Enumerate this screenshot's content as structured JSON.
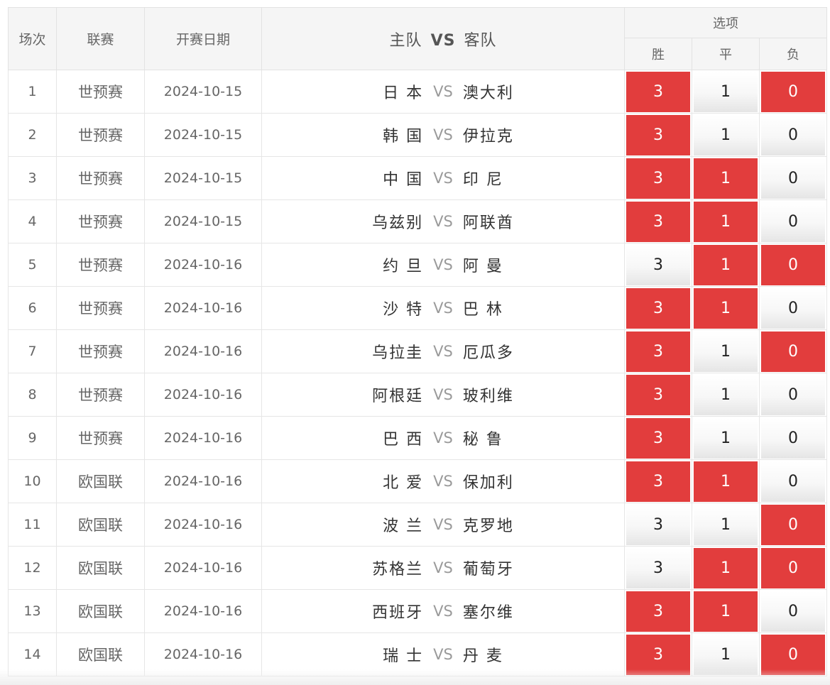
{
  "header": {
    "col_no": "场次",
    "col_league": "联赛",
    "col_date": "开赛日期",
    "col_home": "主队",
    "col_vs": "VS",
    "col_away": "客队",
    "col_options": "选项",
    "opt_win": "胜",
    "opt_draw": "平",
    "opt_lose": "负"
  },
  "colors": {
    "selected": "#e23d3d",
    "header_bg": "#f5f5f5"
  },
  "matches": [
    {
      "no": "1",
      "league": "世预赛",
      "date": "2024-10-15",
      "home": "日 本",
      "vs": "VS",
      "away": "澳大利",
      "win": "3",
      "draw": "1",
      "lose": "0",
      "sel_win": true,
      "sel_draw": false,
      "sel_lose": true
    },
    {
      "no": "2",
      "league": "世预赛",
      "date": "2024-10-15",
      "home": "韩 国",
      "vs": "VS",
      "away": "伊拉克",
      "win": "3",
      "draw": "1",
      "lose": "0",
      "sel_win": true,
      "sel_draw": false,
      "sel_lose": false
    },
    {
      "no": "3",
      "league": "世预赛",
      "date": "2024-10-15",
      "home": "中 国",
      "vs": "VS",
      "away": "印 尼",
      "win": "3",
      "draw": "1",
      "lose": "0",
      "sel_win": true,
      "sel_draw": true,
      "sel_lose": false
    },
    {
      "no": "4",
      "league": "世预赛",
      "date": "2024-10-15",
      "home": "乌兹别",
      "vs": "VS",
      "away": "阿联酋",
      "win": "3",
      "draw": "1",
      "lose": "0",
      "sel_win": true,
      "sel_draw": true,
      "sel_lose": false
    },
    {
      "no": "5",
      "league": "世预赛",
      "date": "2024-10-16",
      "home": "约 旦",
      "vs": "VS",
      "away": "阿 曼",
      "win": "3",
      "draw": "1",
      "lose": "0",
      "sel_win": false,
      "sel_draw": true,
      "sel_lose": true
    },
    {
      "no": "6",
      "league": "世预赛",
      "date": "2024-10-16",
      "home": "沙 特",
      "vs": "VS",
      "away": "巴 林",
      "win": "3",
      "draw": "1",
      "lose": "0",
      "sel_win": true,
      "sel_draw": true,
      "sel_lose": false
    },
    {
      "no": "7",
      "league": "世预赛",
      "date": "2024-10-16",
      "home": "乌拉圭",
      "vs": "VS",
      "away": "厄瓜多",
      "win": "3",
      "draw": "1",
      "lose": "0",
      "sel_win": true,
      "sel_draw": false,
      "sel_lose": true
    },
    {
      "no": "8",
      "league": "世预赛",
      "date": "2024-10-16",
      "home": "阿根廷",
      "vs": "VS",
      "away": "玻利维",
      "win": "3",
      "draw": "1",
      "lose": "0",
      "sel_win": true,
      "sel_draw": false,
      "sel_lose": false
    },
    {
      "no": "9",
      "league": "世预赛",
      "date": "2024-10-16",
      "home": "巴 西",
      "vs": "VS",
      "away": "秘 鲁",
      "win": "3",
      "draw": "1",
      "lose": "0",
      "sel_win": true,
      "sel_draw": false,
      "sel_lose": false
    },
    {
      "no": "10",
      "league": "欧国联",
      "date": "2024-10-16",
      "home": "北 爱",
      "vs": "VS",
      "away": "保加利",
      "win": "3",
      "draw": "1",
      "lose": "0",
      "sel_win": true,
      "sel_draw": true,
      "sel_lose": false
    },
    {
      "no": "11",
      "league": "欧国联",
      "date": "2024-10-16",
      "home": "波 兰",
      "vs": "VS",
      "away": "克罗地",
      "win": "3",
      "draw": "1",
      "lose": "0",
      "sel_win": false,
      "sel_draw": false,
      "sel_lose": true
    },
    {
      "no": "12",
      "league": "欧国联",
      "date": "2024-10-16",
      "home": "苏格兰",
      "vs": "VS",
      "away": "葡萄牙",
      "win": "3",
      "draw": "1",
      "lose": "0",
      "sel_win": false,
      "sel_draw": true,
      "sel_lose": true
    },
    {
      "no": "13",
      "league": "欧国联",
      "date": "2024-10-16",
      "home": "西班牙",
      "vs": "VS",
      "away": "塞尔维",
      "win": "3",
      "draw": "1",
      "lose": "0",
      "sel_win": true,
      "sel_draw": true,
      "sel_lose": false
    },
    {
      "no": "14",
      "league": "欧国联",
      "date": "2024-10-16",
      "home": "瑞 士",
      "vs": "VS",
      "away": "丹 麦",
      "win": "3",
      "draw": "1",
      "lose": "0",
      "sel_win": true,
      "sel_draw": false,
      "sel_lose": true
    }
  ]
}
